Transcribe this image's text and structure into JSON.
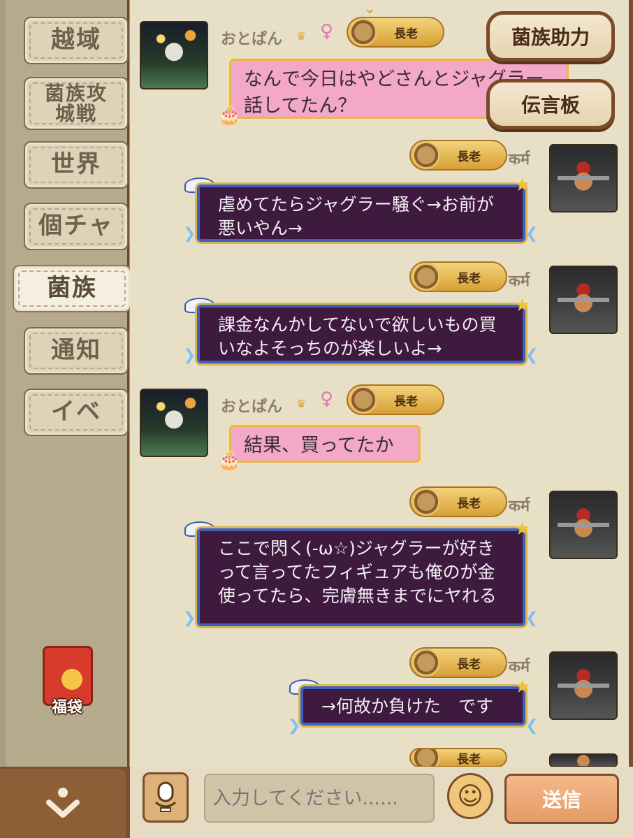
{
  "sidebar": {
    "tabs": [
      {
        "label": "越域"
      },
      {
        "label": "菌族攻城戦"
      },
      {
        "label": "世界"
      },
      {
        "label": "個チャ"
      },
      {
        "label": "菌族",
        "active": true
      },
      {
        "label": "通知"
      },
      {
        "label": "イベ"
      }
    ],
    "fukubukuro_label": "福袋"
  },
  "floating_buttons": {
    "clan_help": "菌族助力",
    "message_board": "伝言板"
  },
  "messages": [
    {
      "sender": "おとぱん",
      "rank": "長老",
      "text": "なんで今日はやどさんとジャグラー 話してたん？",
      "side": "left"
    },
    {
      "sender": "कर्म",
      "rank": "長老",
      "text": "虐めてたらジャグラー騒ぐ→お前が悪いやん→",
      "side": "right"
    },
    {
      "sender": "कर्म",
      "rank": "長老",
      "text": "課金なんかしてないで欲しいもの買いなよそっちのが楽しいよ→",
      "side": "right"
    },
    {
      "sender": "おとぱん",
      "rank": "長老",
      "text": "結果、買ってたか",
      "side": "left"
    },
    {
      "sender": "कर्म",
      "rank": "長老",
      "text": "ここで閃く(-ω☆)ジャグラーが好きって言ってたフィギュアも俺のが金使ってたら、完膚無きまでにヤれる",
      "side": "right"
    },
    {
      "sender": "कर्म",
      "rank": "長老",
      "text": "→何故か負けた　です",
      "side": "right"
    },
    {
      "sender": "",
      "rank": "長老",
      "text": "",
      "side": "right"
    }
  ],
  "input_bar": {
    "placeholder": "入力してください......",
    "send_label": "送信"
  },
  "icons": {
    "voice": "microphone-icon",
    "emoji": "smiley-icon",
    "collapse": "chevron-down-icon"
  },
  "colors": {
    "pink_bubble": "#f2a8c6",
    "dark_bubble": "#3e1a3e",
    "rank_gold": "#e0b04a"
  }
}
